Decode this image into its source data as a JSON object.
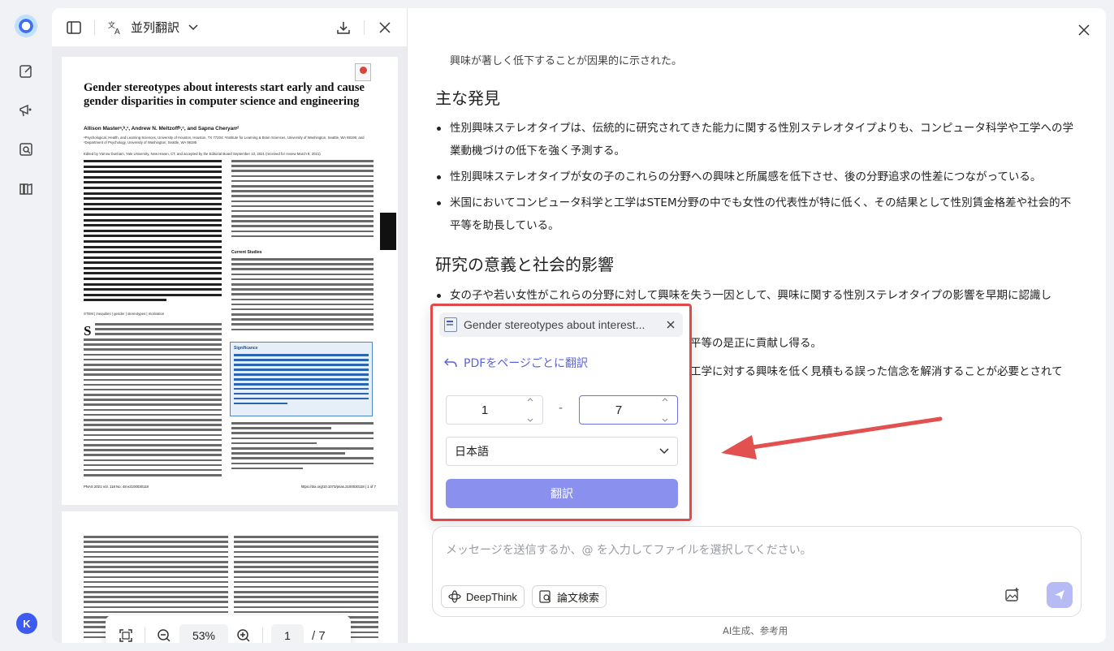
{
  "rail": {
    "avatar_letter": "K",
    "icons": [
      "app-logo-icon",
      "edit-icon",
      "megaphone-icon",
      "search-doc-icon",
      "library-icon"
    ]
  },
  "pdf_panel": {
    "mode_label": "並列翻訳",
    "page1": {
      "title": "Gender stereotypes about interests start early and cause gender disparities in computer science and engineering",
      "authors": "Allison Masterᵃ,ᵇ,¹, Andrew N. Meltzoffᵇ,ᶜ, and Sapna Cheryanᵈ",
      "affiliations": "ᵃPsychological, Health, and Learning Sciences, University of Houston, Houston, TX 77204; ᵇInstitute for Learning & Brain Sciences, University of Washington, Seattle, WA 98195; and ᶜDepartment of Psychology, University of Washington, Seattle, WA 98195",
      "edited": "Edited by Yarrow Dunham, Yale University, New Haven, CT, and accepted by the Editorial Board September 10, 2021 (received for review March 8, 2021)",
      "keywords": "STEM | inequities | gender | stereotypes | motivation",
      "subhead": "Current Studies",
      "significance": "Significance",
      "dropcap": "S",
      "footer_left": "PNAS 2021 Vol. 118 No. 48 e2100030118",
      "footer_right": "https://doi.org/10.1073/pnas.2100030118 | 1 of 7"
    },
    "zoom": {
      "value": "53%",
      "page": "1",
      "total": "/ 7"
    }
  },
  "chat": {
    "top_line": "興味が著しく低下することが因果的に示された。",
    "sections": [
      {
        "heading": "主な発見",
        "bullets": [
          "性別興味ステレオタイプは、伝統的に研究されてきた能力に関する性別ステレオタイプよりも、コンピュータ科学や工学への学業動機づけの低下を強く予測する。",
          "性別興味ステレオタイプが女の子のこれらの分野への興味と所属感を低下させ、後の分野追求の性差につながっている。",
          "米国においてコンピュータ科学と工学はSTEM分野の中でも女性の代表性が特に低く、その結果として性別賃金格差や社会的不平等を助長している。"
        ]
      },
      {
        "heading": "研究の意義と社会的影響",
        "bullets": [
          "女の子や若い女性がこれらの分野に対して興味を失う一因として、興味に関する性別ステレオタイプの影響を早期に認識し",
          "平等の是正に貢献し得る。",
          "工学に対する興味を低く見積もる誤った信念を解消することが必要とされて"
        ]
      }
    ]
  },
  "popup": {
    "file_name": "Gender stereotypes about interest...",
    "back_label": "PDFをページごとに翻訳",
    "from_page": "1",
    "to_page": "7",
    "dash": "-",
    "language": "日本語",
    "translate_label": "翻訳"
  },
  "input": {
    "placeholder": "メッセージを送信するか、@ を入力してファイルを選択してください。",
    "deepthink_label": "DeepThink",
    "paper_search_label": "論文検索"
  },
  "footnote": "AI生成、参考用",
  "colors": {
    "accent": "#5b63d8",
    "highlight_border": "#e04a4a",
    "button": "#8a90ee"
  }
}
